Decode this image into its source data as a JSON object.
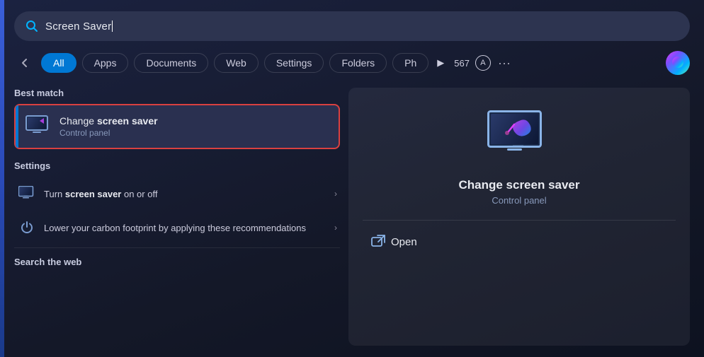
{
  "search": {
    "query": "Screen Saver",
    "placeholder": "Screen Saver"
  },
  "filters": {
    "back_label": "←",
    "tabs": [
      {
        "id": "all",
        "label": "All",
        "active": true
      },
      {
        "id": "apps",
        "label": "Apps",
        "active": false
      },
      {
        "id": "documents",
        "label": "Documents",
        "active": false
      },
      {
        "id": "web",
        "label": "Web",
        "active": false
      },
      {
        "id": "settings",
        "label": "Settings",
        "active": false
      },
      {
        "id": "folders",
        "label": "Folders",
        "active": false
      },
      {
        "id": "photos",
        "label": "Ph",
        "active": false
      }
    ],
    "play_icon": "▶",
    "count": "567",
    "font_icon": "A",
    "more_icon": "···"
  },
  "best_match": {
    "section_title": "Best match",
    "item": {
      "title_plain": "Change ",
      "title_bold": "screen saver",
      "subtitle": "Control panel"
    }
  },
  "settings_section": {
    "section_title": "Settings",
    "items": [
      {
        "title_plain": "Turn ",
        "title_bold": "screen saver",
        "title_suffix": " on or off",
        "has_chevron": true
      },
      {
        "title_plain": "Lower your carbon footprint by applying these recommendations",
        "title_bold": "",
        "title_suffix": "",
        "has_chevron": true
      }
    ]
  },
  "search_web": {
    "section_title": "Search the web"
  },
  "detail_panel": {
    "title_plain": "Change ",
    "title_bold": "screen saver",
    "subtitle": "Control panel",
    "open_label": "Open"
  }
}
